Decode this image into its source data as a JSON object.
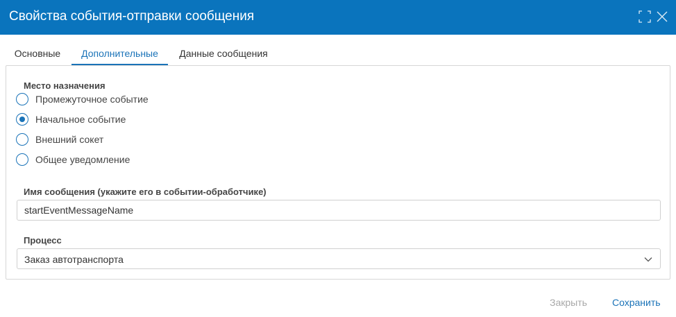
{
  "dialog": {
    "title": "Свойства события-отправки сообщения",
    "header_color": "#0a74bd",
    "maximize_icon": "maximize-icon",
    "close_icon": "close-icon"
  },
  "tabs": [
    {
      "label": "Основные",
      "active": false
    },
    {
      "label": "Дополнительные",
      "active": true
    },
    {
      "label": "Данные сообщения",
      "active": false
    }
  ],
  "destination": {
    "label": "Место назначения",
    "options": [
      {
        "label": "Промежуточное событие",
        "checked": false
      },
      {
        "label": "Начальное событие",
        "checked": true
      },
      {
        "label": "Внешний сокет",
        "checked": false
      },
      {
        "label": "Общее уведомление",
        "checked": false
      }
    ]
  },
  "message_name": {
    "label": "Имя сообщения (укажите его в событии-обработчике)",
    "value": "startEventMessageName"
  },
  "process": {
    "label": "Процесс",
    "selected": "Заказ автотранспорта"
  },
  "footer": {
    "close_label": "Закрыть",
    "save_label": "Сохранить"
  },
  "colors": {
    "accent": "#1a73b8",
    "disabled_text": "#a8a8a8"
  }
}
